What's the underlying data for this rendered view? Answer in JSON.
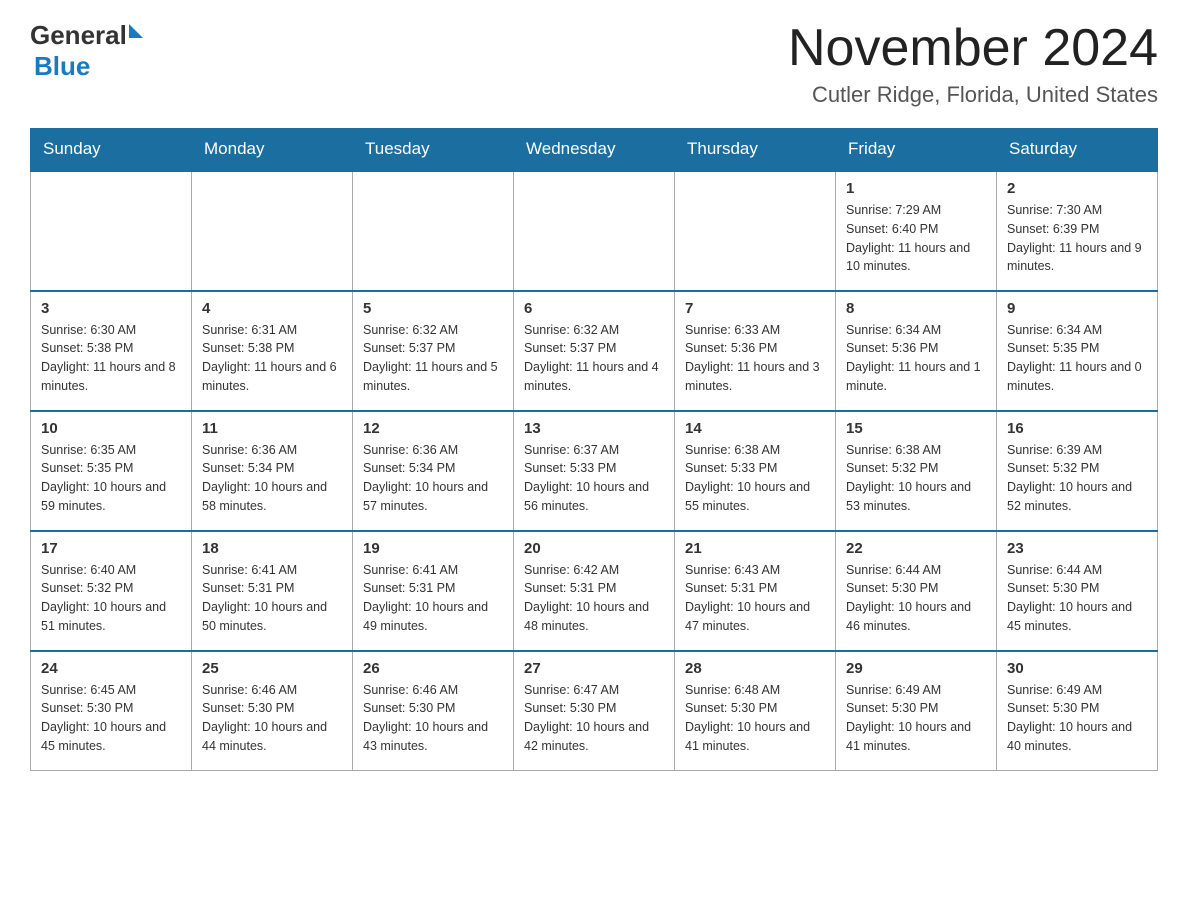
{
  "header": {
    "logo_general": "General",
    "logo_blue": "Blue",
    "month_title": "November 2024",
    "location": "Cutler Ridge, Florida, United States"
  },
  "weekdays": [
    "Sunday",
    "Monday",
    "Tuesday",
    "Wednesday",
    "Thursday",
    "Friday",
    "Saturday"
  ],
  "weeks": [
    [
      {
        "day": "",
        "info": ""
      },
      {
        "day": "",
        "info": ""
      },
      {
        "day": "",
        "info": ""
      },
      {
        "day": "",
        "info": ""
      },
      {
        "day": "",
        "info": ""
      },
      {
        "day": "1",
        "info": "Sunrise: 7:29 AM\nSunset: 6:40 PM\nDaylight: 11 hours and 10 minutes."
      },
      {
        "day": "2",
        "info": "Sunrise: 7:30 AM\nSunset: 6:39 PM\nDaylight: 11 hours and 9 minutes."
      }
    ],
    [
      {
        "day": "3",
        "info": "Sunrise: 6:30 AM\nSunset: 5:38 PM\nDaylight: 11 hours and 8 minutes."
      },
      {
        "day": "4",
        "info": "Sunrise: 6:31 AM\nSunset: 5:38 PM\nDaylight: 11 hours and 6 minutes."
      },
      {
        "day": "5",
        "info": "Sunrise: 6:32 AM\nSunset: 5:37 PM\nDaylight: 11 hours and 5 minutes."
      },
      {
        "day": "6",
        "info": "Sunrise: 6:32 AM\nSunset: 5:37 PM\nDaylight: 11 hours and 4 minutes."
      },
      {
        "day": "7",
        "info": "Sunrise: 6:33 AM\nSunset: 5:36 PM\nDaylight: 11 hours and 3 minutes."
      },
      {
        "day": "8",
        "info": "Sunrise: 6:34 AM\nSunset: 5:36 PM\nDaylight: 11 hours and 1 minute."
      },
      {
        "day": "9",
        "info": "Sunrise: 6:34 AM\nSunset: 5:35 PM\nDaylight: 11 hours and 0 minutes."
      }
    ],
    [
      {
        "day": "10",
        "info": "Sunrise: 6:35 AM\nSunset: 5:35 PM\nDaylight: 10 hours and 59 minutes."
      },
      {
        "day": "11",
        "info": "Sunrise: 6:36 AM\nSunset: 5:34 PM\nDaylight: 10 hours and 58 minutes."
      },
      {
        "day": "12",
        "info": "Sunrise: 6:36 AM\nSunset: 5:34 PM\nDaylight: 10 hours and 57 minutes."
      },
      {
        "day": "13",
        "info": "Sunrise: 6:37 AM\nSunset: 5:33 PM\nDaylight: 10 hours and 56 minutes."
      },
      {
        "day": "14",
        "info": "Sunrise: 6:38 AM\nSunset: 5:33 PM\nDaylight: 10 hours and 55 minutes."
      },
      {
        "day": "15",
        "info": "Sunrise: 6:38 AM\nSunset: 5:32 PM\nDaylight: 10 hours and 53 minutes."
      },
      {
        "day": "16",
        "info": "Sunrise: 6:39 AM\nSunset: 5:32 PM\nDaylight: 10 hours and 52 minutes."
      }
    ],
    [
      {
        "day": "17",
        "info": "Sunrise: 6:40 AM\nSunset: 5:32 PM\nDaylight: 10 hours and 51 minutes."
      },
      {
        "day": "18",
        "info": "Sunrise: 6:41 AM\nSunset: 5:31 PM\nDaylight: 10 hours and 50 minutes."
      },
      {
        "day": "19",
        "info": "Sunrise: 6:41 AM\nSunset: 5:31 PM\nDaylight: 10 hours and 49 minutes."
      },
      {
        "day": "20",
        "info": "Sunrise: 6:42 AM\nSunset: 5:31 PM\nDaylight: 10 hours and 48 minutes."
      },
      {
        "day": "21",
        "info": "Sunrise: 6:43 AM\nSunset: 5:31 PM\nDaylight: 10 hours and 47 minutes."
      },
      {
        "day": "22",
        "info": "Sunrise: 6:44 AM\nSunset: 5:30 PM\nDaylight: 10 hours and 46 minutes."
      },
      {
        "day": "23",
        "info": "Sunrise: 6:44 AM\nSunset: 5:30 PM\nDaylight: 10 hours and 45 minutes."
      }
    ],
    [
      {
        "day": "24",
        "info": "Sunrise: 6:45 AM\nSunset: 5:30 PM\nDaylight: 10 hours and 45 minutes."
      },
      {
        "day": "25",
        "info": "Sunrise: 6:46 AM\nSunset: 5:30 PM\nDaylight: 10 hours and 44 minutes."
      },
      {
        "day": "26",
        "info": "Sunrise: 6:46 AM\nSunset: 5:30 PM\nDaylight: 10 hours and 43 minutes."
      },
      {
        "day": "27",
        "info": "Sunrise: 6:47 AM\nSunset: 5:30 PM\nDaylight: 10 hours and 42 minutes."
      },
      {
        "day": "28",
        "info": "Sunrise: 6:48 AM\nSunset: 5:30 PM\nDaylight: 10 hours and 41 minutes."
      },
      {
        "day": "29",
        "info": "Sunrise: 6:49 AM\nSunset: 5:30 PM\nDaylight: 10 hours and 41 minutes."
      },
      {
        "day": "30",
        "info": "Sunrise: 6:49 AM\nSunset: 5:30 PM\nDaylight: 10 hours and 40 minutes."
      }
    ]
  ]
}
